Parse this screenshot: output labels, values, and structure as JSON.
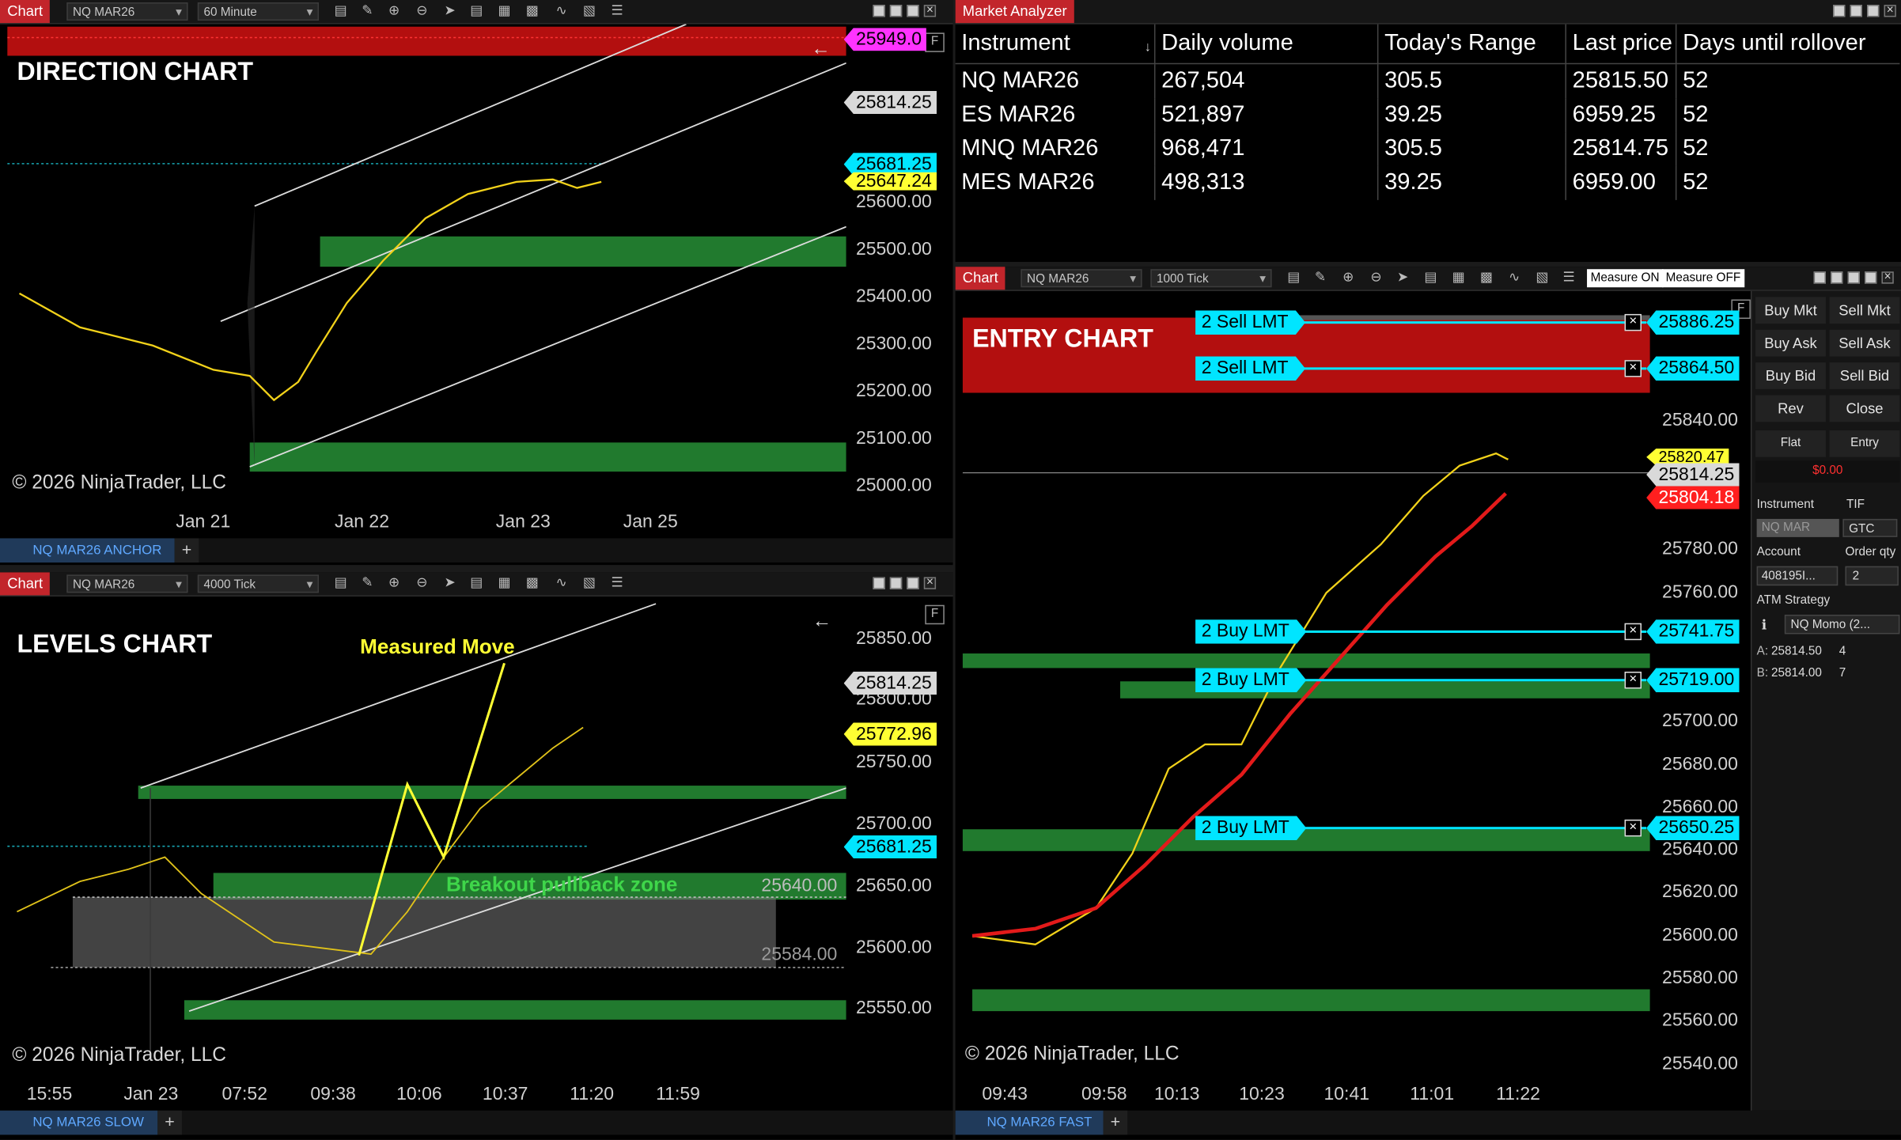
{
  "direction": {
    "window_label": "Chart",
    "instrument": "NQ MAR26",
    "interval": "60 Minute",
    "title": "DIRECTION CHART",
    "flag": "F",
    "prices": [
      "25500.00",
      "25400.00",
      "25300.00",
      "25200.00",
      "25100.00",
      "25000.00"
    ],
    "price_600": "25600.00",
    "tags": {
      "magenta": "25949.0",
      "last": "25814.25",
      "cyan": "25681.25",
      "yellow": "25647.24"
    },
    "dates": [
      "Jan 21",
      "Jan 22",
      "Jan 23",
      "Jan 25"
    ],
    "copyright": "© 2026 NinjaTrader, LLC",
    "tab": "NQ MAR26 ANCHOR"
  },
  "levels": {
    "window_label": "Chart",
    "instrument": "NQ MAR26",
    "interval": "4000 Tick",
    "title": "LEVELS CHART",
    "flag": "F",
    "measured_move": "Measured Move",
    "breakout_zone": "Breakout pullback zone",
    "zone_high": "25640.00",
    "zone_low": "25584.00",
    "prices": [
      "25850.00",
      "25800.00",
      "25750.00",
      "25700.00",
      "25650.00",
      "25600.00",
      "25550.00"
    ],
    "tags": {
      "last": "25814.25",
      "yellow": "25772.96",
      "cyan": "25681.25"
    },
    "times": [
      "15:55",
      "Jan 23",
      "07:52",
      "09:38",
      "10:06",
      "10:37",
      "11:20",
      "11:59"
    ],
    "copyright": "© 2026 NinjaTrader, LLC",
    "tab": "NQ MAR26 SLOW"
  },
  "analyzer": {
    "window_label": "Market Analyzer",
    "columns": [
      "Instrument",
      "Daily volume",
      "Today's Range",
      "Last price",
      "Days until rollover"
    ],
    "rows": [
      [
        "NQ MAR26",
        "267,504",
        "305.5",
        "25815.50",
        "52"
      ],
      [
        "ES MAR26",
        "521,897",
        "39.25",
        "6959.25",
        "52"
      ],
      [
        "MNQ MAR26",
        "968,471",
        "305.5",
        "25814.75",
        "52"
      ],
      [
        "MES MAR26",
        "498,313",
        "39.25",
        "6959.00",
        "52"
      ]
    ]
  },
  "entry": {
    "window_label": "Chart",
    "instrument": "NQ MAR26",
    "interval": "1000 Tick",
    "measure_on": "Measure ON",
    "measure_off": "Measure OFF",
    "title": "ENTRY CHART",
    "flag": "F",
    "prices": [
      "25840.00",
      "25780.00",
      "25760.00",
      "25700.00",
      "25680.00",
      "25660.00",
      "25640.00",
      "25620.00",
      "25600.00",
      "25580.00",
      "25560.00",
      "25540.00"
    ],
    "orders": [
      {
        "label": "2 Sell LMT",
        "price": "25886.25"
      },
      {
        "label": "2 Sell LMT",
        "price": "25864.50"
      },
      {
        "label": "2 Buy LMT",
        "price": "25741.75"
      },
      {
        "label": "2 Buy LMT",
        "price": "25719.00"
      },
      {
        "label": "2 Buy LMT",
        "price": "25650.25"
      }
    ],
    "tags": {
      "yellow": "25820.47",
      "last": "25814.25",
      "red": "25804.18"
    },
    "times": [
      "09:43",
      "09:58",
      "10:13",
      "10:23",
      "10:41",
      "11:01",
      "11:22"
    ],
    "copyright": "© 2026 NinjaTrader, LLC",
    "tab": "NQ MAR26 FAST"
  },
  "chart_trader": {
    "buttons": [
      "Buy Mkt",
      "Sell Mkt",
      "Buy Ask",
      "Sell Ask",
      "Buy Bid",
      "Sell Bid",
      "Rev",
      "Close",
      "Flat",
      "Entry"
    ],
    "pnl": "$0.00",
    "instrument_label": "Instrument",
    "tif_label": "TIF",
    "instrument": "NQ MAR",
    "tif": "GTC",
    "account_label": "Account",
    "qty_label": "Order qty",
    "account": "408195I...",
    "qty": "2",
    "atm_label": "ATM Strategy",
    "atm": "NQ Momo (2...",
    "ask_label": "A:",
    "ask": "25814.50",
    "ask_size": "4",
    "bid_label": "B:",
    "bid": "25814.00",
    "bid_size": "7"
  },
  "colors": {
    "accent_red": "#c2252b",
    "zone_green": "#217a2e",
    "order_cyan": "#00e5ff",
    "tag_magenta": "#ff33ff",
    "tag_yellow": "#ffff33"
  }
}
